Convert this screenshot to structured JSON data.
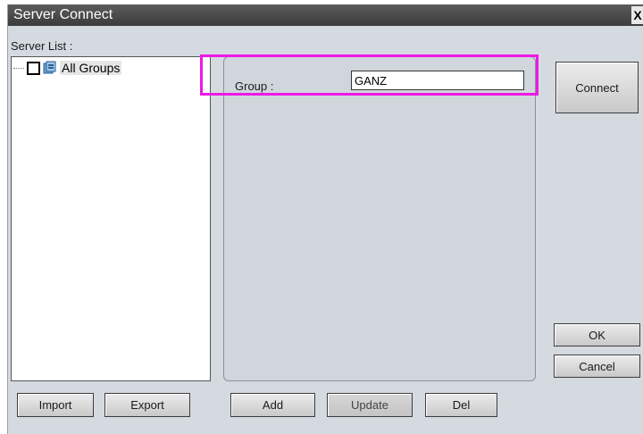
{
  "window": {
    "title": "Server Connect",
    "close_label": "X"
  },
  "server_list": {
    "label": "Server List :",
    "tree": [
      {
        "label": "All Groups",
        "checked": false,
        "icon": "group-folder-icon"
      }
    ]
  },
  "group_panel": {
    "label": "Group :",
    "value": "GANZ",
    "highlight_color": "#ee19e4"
  },
  "buttons": {
    "connect": "Connect",
    "ok": "OK",
    "cancel": "Cancel",
    "import": "Import",
    "export": "Export",
    "add": "Add",
    "update": "Update",
    "del": "Del"
  }
}
